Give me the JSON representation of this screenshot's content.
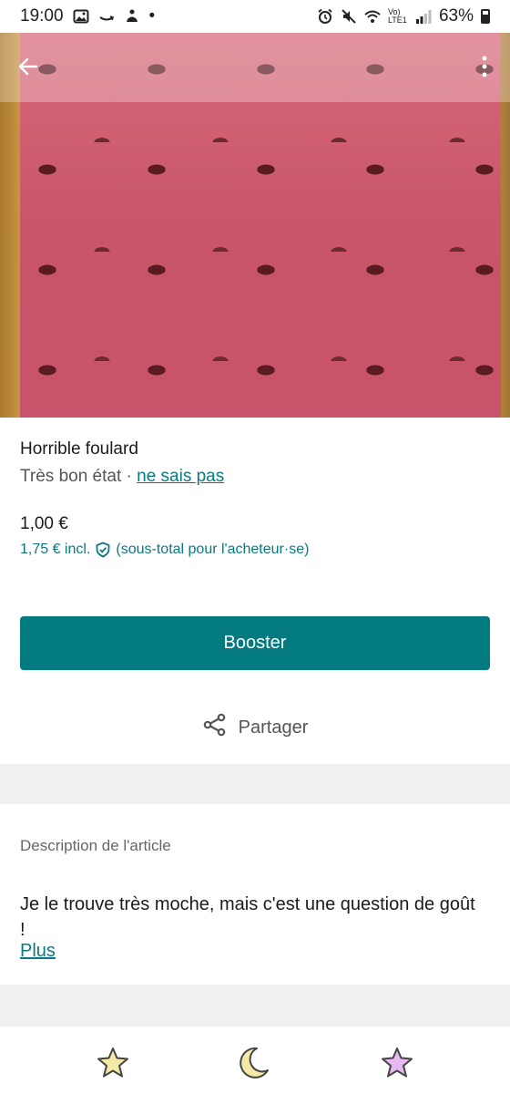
{
  "status_bar": {
    "time": "19:00",
    "dot": "•",
    "network": "Vo) LTE1",
    "battery": "63%"
  },
  "hero": {
    "image_alt": "Pink leopard-print scarf",
    "back_icon": "arrow-left-icon",
    "more_icon": "more-vertical-icon"
  },
  "item": {
    "title": "Horrible foulard",
    "condition": "Très bon état",
    "separator": " · ",
    "brand": "ne sais pas",
    "price": "1,00 €",
    "price_incl": "1,75 € incl.",
    "price_incl_note": "(sous-total pour l'acheteur·se)"
  },
  "actions": {
    "boost_label": "Booster",
    "share_label": "Partager"
  },
  "description": {
    "heading": "Description de l'article",
    "body": "Je le trouve très moche, mais c'est une question de goût !",
    "more_label": "Plus"
  },
  "bottom_icons": [
    "star-icon",
    "moon-icon",
    "star-icon"
  ],
  "colors": {
    "accent": "#027a80",
    "link": "#0b7a80",
    "band": "#f0f0f0"
  }
}
